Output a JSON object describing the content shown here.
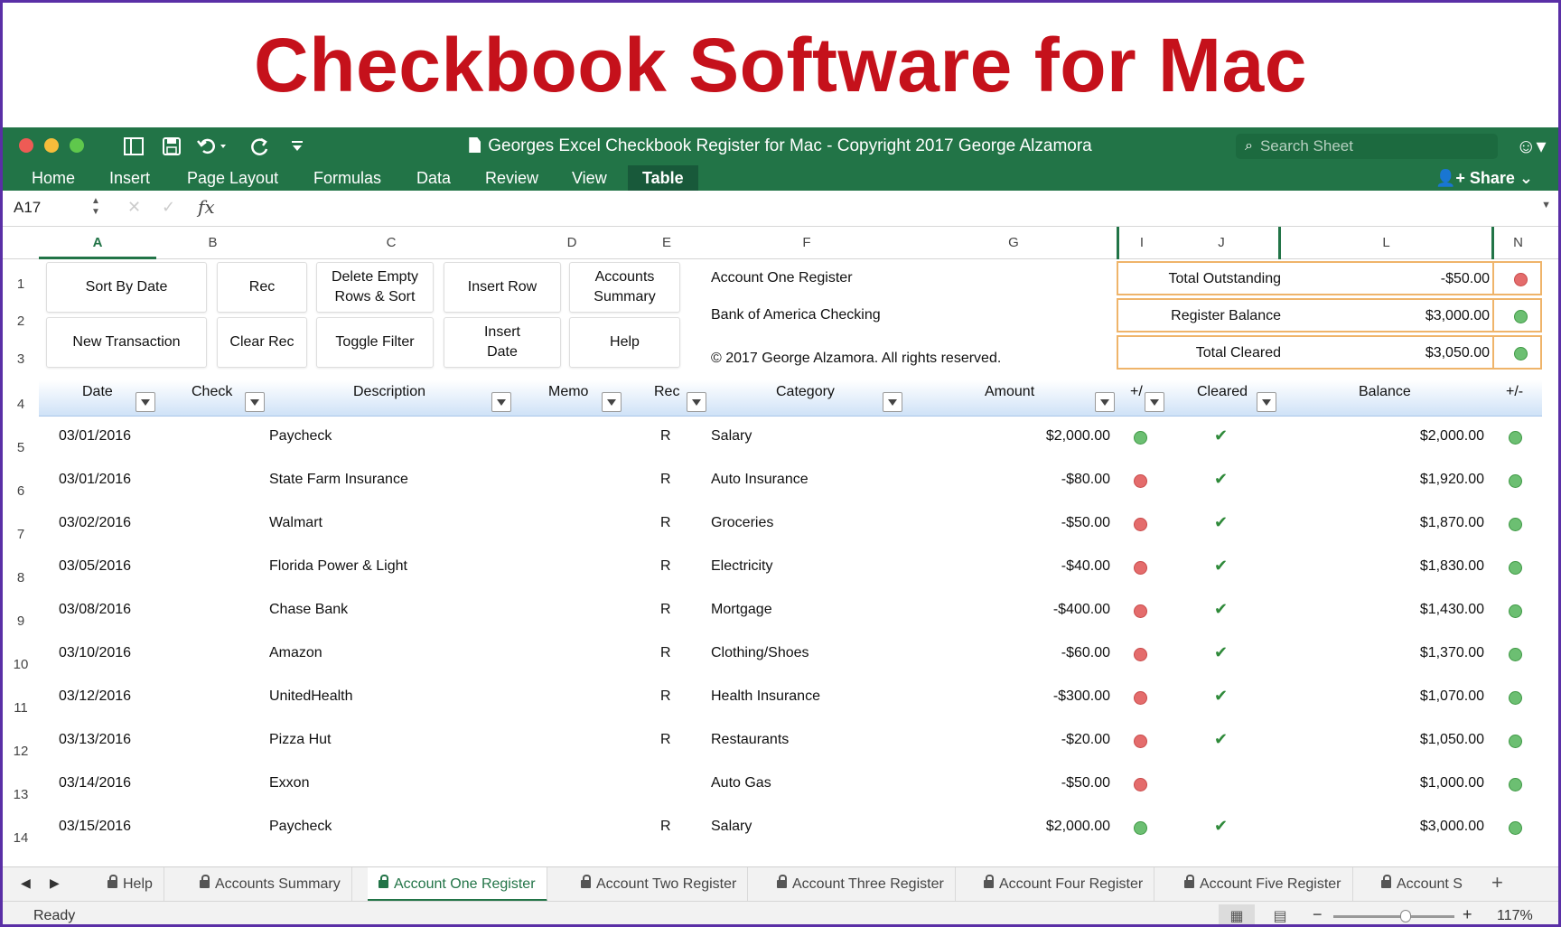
{
  "banner": {
    "title": "Checkbook Software for Mac"
  },
  "window": {
    "title": "Georges Excel Checkbook Register for Mac - Copyright 2017 George Alzamora",
    "search_placeholder": "Search Sheet",
    "toolbar_icons": [
      "sidebar-icon",
      "save-icon",
      "undo-icon",
      "redo-icon",
      "customize-icon"
    ]
  },
  "ribbon": {
    "tabs": [
      "Home",
      "Insert",
      "Page Layout",
      "Formulas",
      "Data",
      "Review",
      "View",
      "Table"
    ],
    "active_tab": "Table",
    "share_label": "Share"
  },
  "formula_bar": {
    "name_box": "A17",
    "fx_label": "fx",
    "formula": ""
  },
  "columns": [
    "A",
    "B",
    "C",
    "D",
    "E",
    "F",
    "G",
    "I",
    "J",
    "L",
    "N"
  ],
  "selected_column": "A",
  "row_numbers": [
    "1",
    "2",
    "3",
    "4",
    "5",
    "6",
    "7",
    "8",
    "9",
    "10",
    "11",
    "12",
    "13",
    "14"
  ],
  "buttons": {
    "sort_by_date": "Sort By Date",
    "rec": "Rec",
    "delete_empty_l1": "Delete Empty",
    "delete_empty_l2": "Rows & Sort",
    "insert_row": "Insert Row",
    "accounts_summary_l1": "Accounts",
    "accounts_summary_l2": "Summary",
    "new_transaction": "New Transaction",
    "clear_rec": "Clear Rec",
    "toggle_filter": "Toggle Filter",
    "insert_date_l1": "Insert",
    "insert_date_l2": "Date",
    "help": "Help"
  },
  "account_info": {
    "name": "Account One Register",
    "bank": "Bank of America Checking",
    "copyright": "© 2017 George Alzamora.  All rights reserved."
  },
  "summary": [
    {
      "label": "Total Outstanding",
      "value": "-$50.00",
      "status": "red"
    },
    {
      "label": "Register Balance",
      "value": "$3,000.00",
      "status": "green"
    },
    {
      "label": "Total Cleared",
      "value": "$3,050.00",
      "status": "green"
    }
  ],
  "table_headers": {
    "date": "Date",
    "check": "Check",
    "description": "Description",
    "memo": "Memo",
    "rec": "Rec",
    "category": "Category",
    "amount": "Amount",
    "plusminus": "+/",
    "cleared": "Cleared",
    "balance": "Balance",
    "balance_plusminus": "+/-"
  },
  "transactions": [
    {
      "date": "03/01/2016",
      "check": "",
      "description": "Paycheck",
      "memo": "",
      "rec": "R",
      "category": "Salary",
      "amount": "$2,000.00",
      "amount_status": "green",
      "cleared": true,
      "balance": "$2,000.00",
      "balance_status": "green"
    },
    {
      "date": "03/01/2016",
      "check": "",
      "description": "State Farm Insurance",
      "memo": "",
      "rec": "R",
      "category": "Auto Insurance",
      "amount": "-$80.00",
      "amount_status": "red",
      "cleared": true,
      "balance": "$1,920.00",
      "balance_status": "green"
    },
    {
      "date": "03/02/2016",
      "check": "",
      "description": "Walmart",
      "memo": "",
      "rec": "R",
      "category": "Groceries",
      "amount": "-$50.00",
      "amount_status": "red",
      "cleared": true,
      "balance": "$1,870.00",
      "balance_status": "green"
    },
    {
      "date": "03/05/2016",
      "check": "",
      "description": "Florida Power & Light",
      "memo": "",
      "rec": "R",
      "category": "Electricity",
      "amount": "-$40.00",
      "amount_status": "red",
      "cleared": true,
      "balance": "$1,830.00",
      "balance_status": "green"
    },
    {
      "date": "03/08/2016",
      "check": "",
      "description": "Chase Bank",
      "memo": "",
      "rec": "R",
      "category": "Mortgage",
      "amount": "-$400.00",
      "amount_status": "red",
      "cleared": true,
      "balance": "$1,430.00",
      "balance_status": "green"
    },
    {
      "date": "03/10/2016",
      "check": "",
      "description": "Amazon",
      "memo": "",
      "rec": "R",
      "category": "Clothing/Shoes",
      "amount": "-$60.00",
      "amount_status": "red",
      "cleared": true,
      "balance": "$1,370.00",
      "balance_status": "green"
    },
    {
      "date": "03/12/2016",
      "check": "",
      "description": "UnitedHealth",
      "memo": "",
      "rec": "R",
      "category": "Health Insurance",
      "amount": "-$300.00",
      "amount_status": "red",
      "cleared": true,
      "balance": "$1,070.00",
      "balance_status": "green"
    },
    {
      "date": "03/13/2016",
      "check": "",
      "description": "Pizza Hut",
      "memo": "",
      "rec": "R",
      "category": "Restaurants",
      "amount": "-$20.00",
      "amount_status": "red",
      "cleared": true,
      "balance": "$1,050.00",
      "balance_status": "green"
    },
    {
      "date": "03/14/2016",
      "check": "",
      "description": "Exxon",
      "memo": "",
      "rec": "",
      "category": "Auto Gas",
      "amount": "-$50.00",
      "amount_status": "red",
      "cleared": false,
      "balance": "$1,000.00",
      "balance_status": "green"
    },
    {
      "date": "03/15/2016",
      "check": "",
      "description": "Paycheck",
      "memo": "",
      "rec": "R",
      "category": "Salary",
      "amount": "$2,000.00",
      "amount_status": "green",
      "cleared": true,
      "balance": "$3,000.00",
      "balance_status": "green"
    }
  ],
  "sheet_tabs": [
    "Help",
    "Accounts Summary",
    "Account One Register",
    "Account Two Register",
    "Account Three Register",
    "Account Four Register",
    "Account Five Register",
    "Account S"
  ],
  "active_sheet": "Account One Register",
  "status": {
    "text": "Ready",
    "zoom": "117%",
    "zoom_fraction": 0.6
  },
  "colors": {
    "banner_red": "#c5111b",
    "excel_green": "#227447",
    "summary_border": "#efb46a",
    "status_red": "#e46c6c",
    "status_green": "#6cbf72",
    "frame": "#5a2fa6"
  }
}
